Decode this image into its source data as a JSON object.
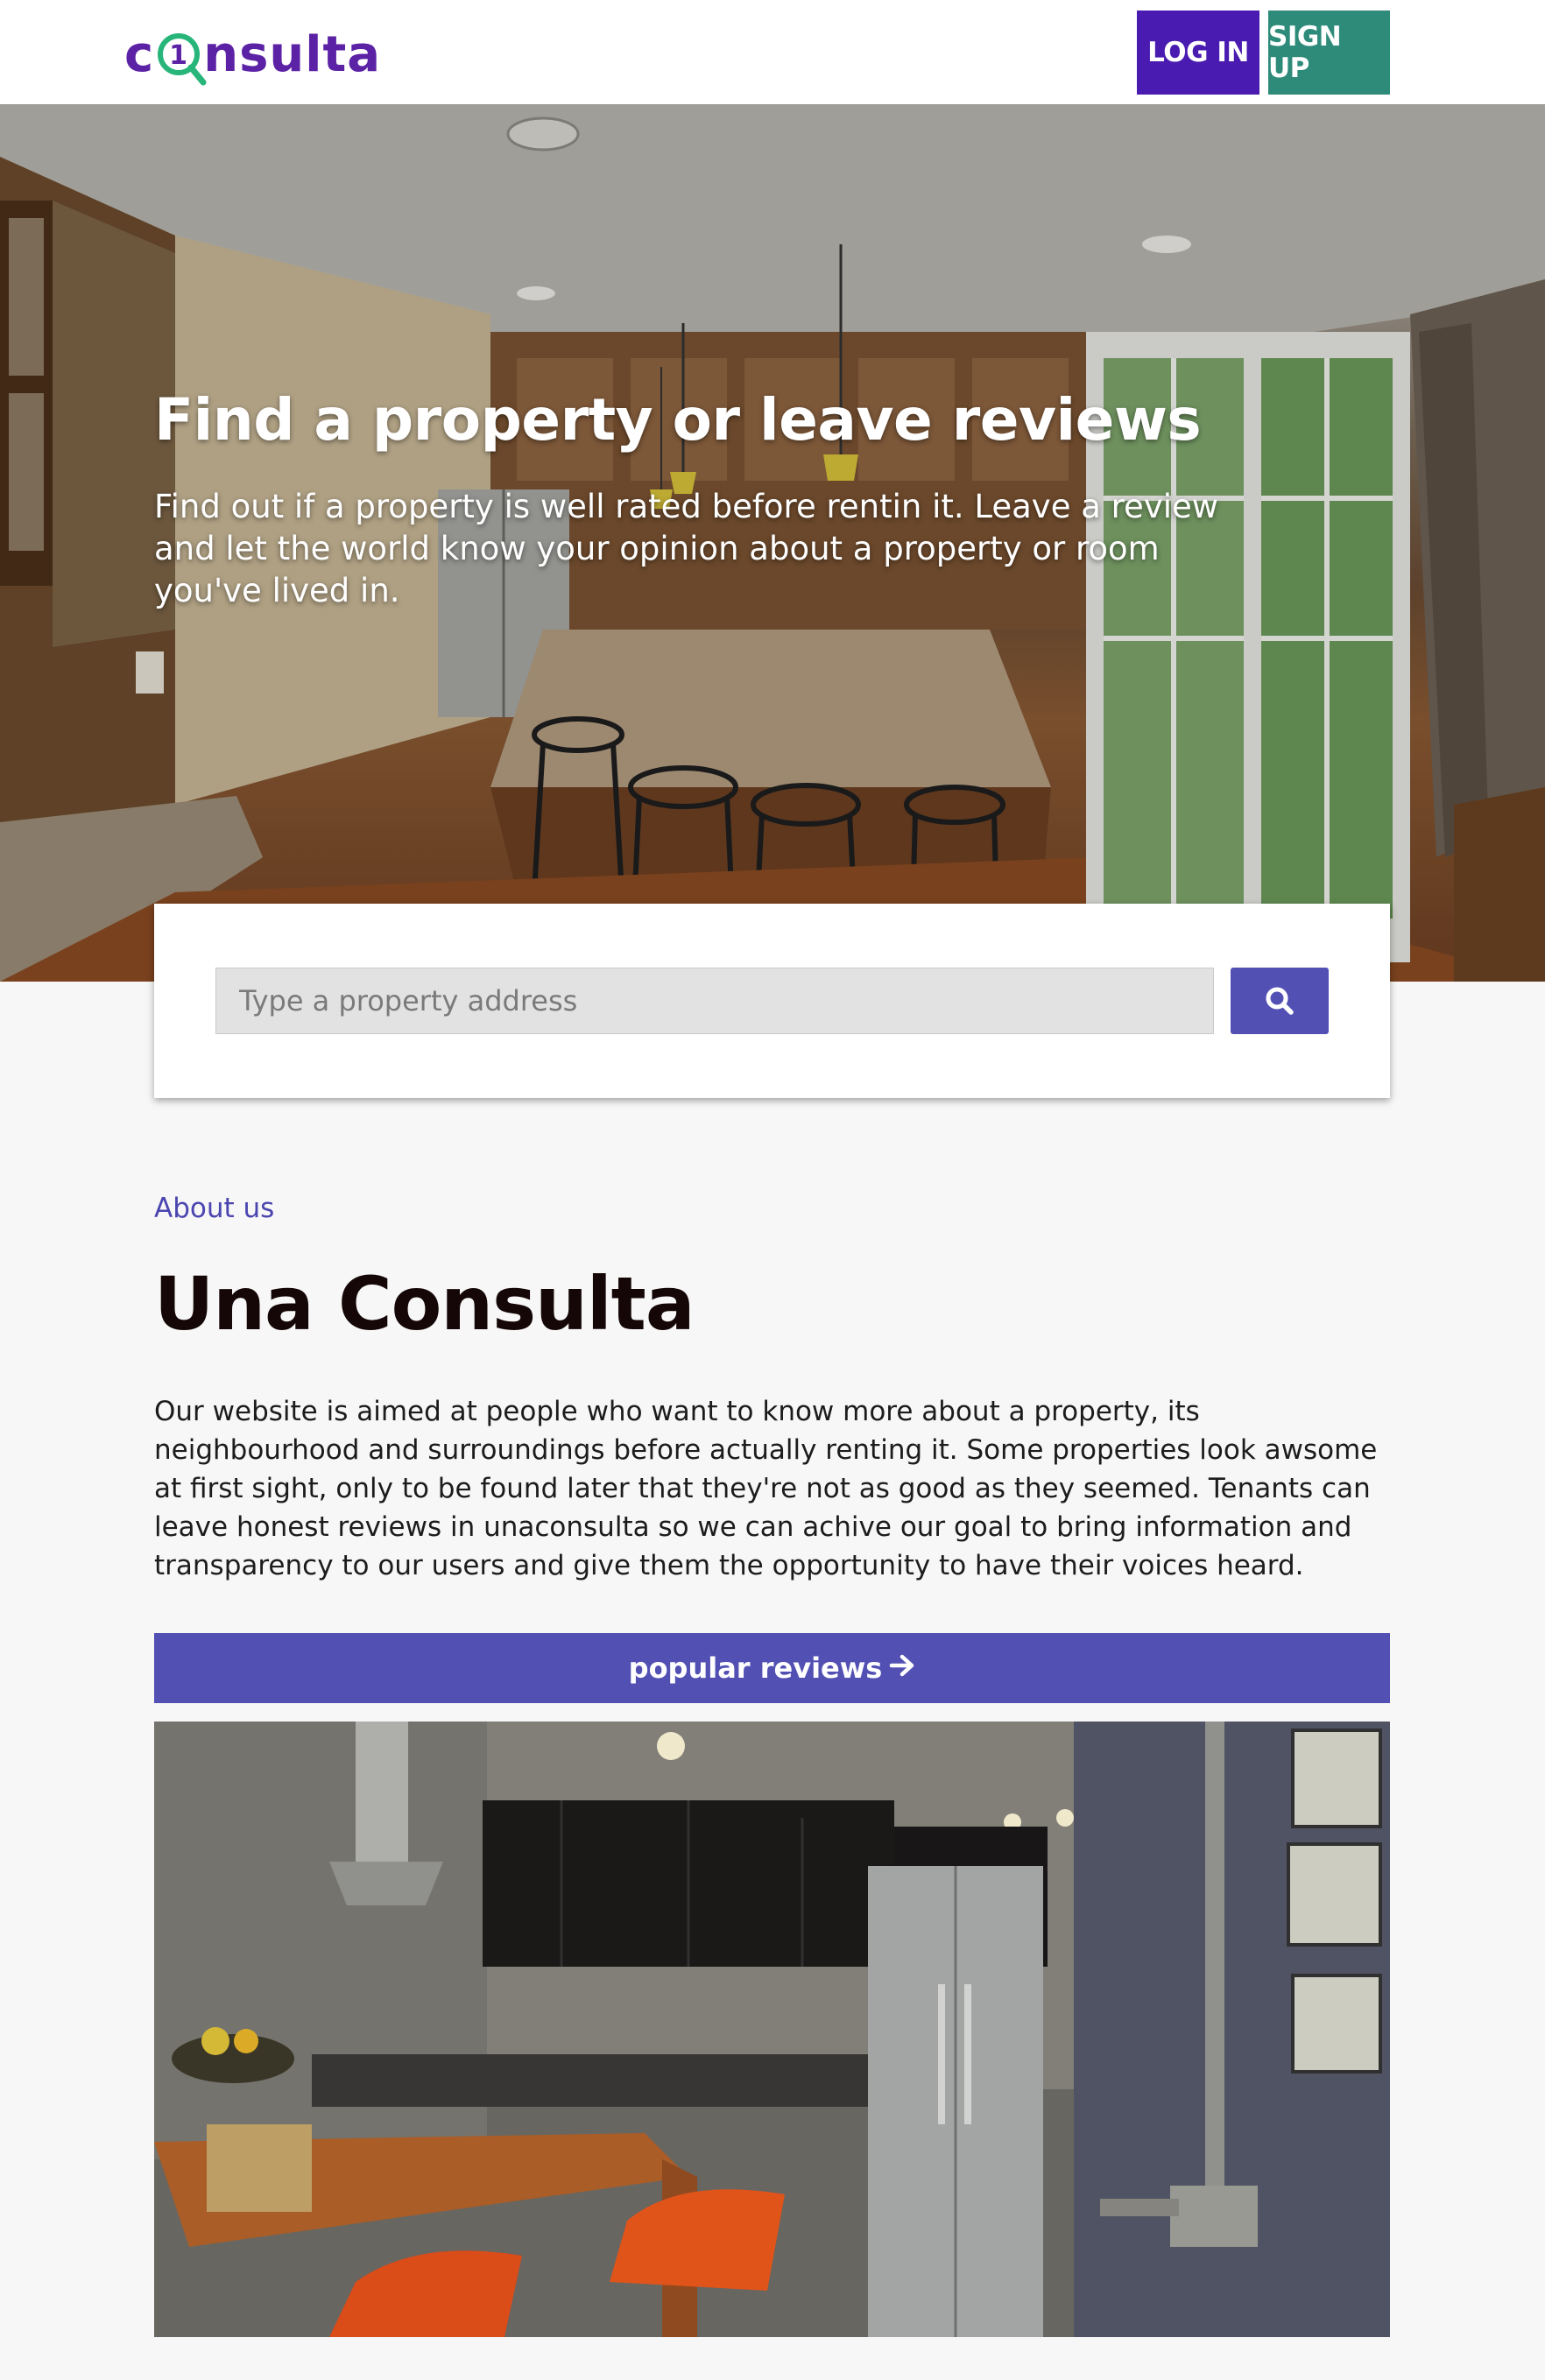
{
  "header": {
    "logo_text_left": "c",
    "logo_digit": "1",
    "logo_text_right": "nsulta",
    "login_label": "LOG IN",
    "signup_label": "SIGN UP"
  },
  "hero": {
    "title": "Find a property or leave reviews",
    "subtitle": "Find out if a property is well rated before rentin it. Leave a review and let the world know your opinion about a property or room you've lived in."
  },
  "search": {
    "placeholder": "Type a property address",
    "icon": "search-icon"
  },
  "about": {
    "eyebrow": "About us",
    "title": "Una Consulta",
    "body": "Our website is aimed at people who want to know more about a property, its neighbourhood and surroundings before actually renting it. Some properties look awsome at first sight, only to be found later that they're not as good as they seemed. Tenants can leave honest reviews in unaconsulta so we can achive our goal to bring information and transparency to our users and give them the opportunity to have their voices heard.",
    "popular_label": "popular reviews",
    "popular_icon": "arrow-right-icon"
  },
  "colors": {
    "brand_purple": "#5c22a6",
    "login_bg": "#4a1bb0",
    "signup_bg": "#2e8b7a",
    "accent": "#5350b4",
    "logo_green": "#27b57a"
  }
}
